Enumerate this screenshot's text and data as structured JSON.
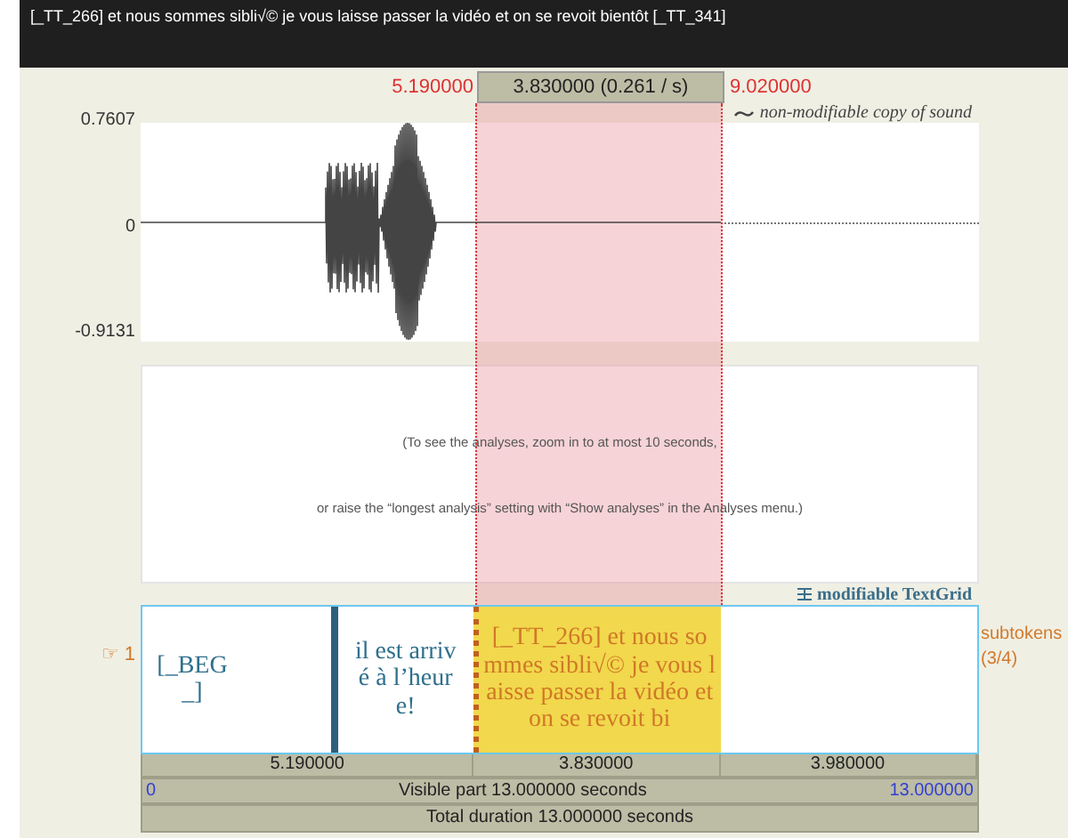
{
  "top_bar": {
    "text": "[_TT_266] et nous sommes sibli√© je vous laisse passer la vidéo et on se revoit bientôt [_TT_341]"
  },
  "selection": {
    "start": "5.190000",
    "duration": "3.830000 (0.261 / s)",
    "end": "9.020000"
  },
  "sound": {
    "label": "non-modifiable copy of sound",
    "ymax": "0.7607",
    "yzero": "0",
    "ymin": "-0.9131"
  },
  "analyses_message": [
    "(To see the analyses, zoom in to at most 10 seconds,",
    "or raise the “longest analysis” setting with “Show analyses” in the Analyses menu.)"
  ],
  "textgrid": {
    "label": "modifiable TextGrid",
    "tier": {
      "marker": "☞",
      "number": "1",
      "name": "subtokens",
      "count": "(3/4)",
      "intervals": [
        {
          "text": "[_BEG_]",
          "selected": false
        },
        {
          "text": "il est  arrivé à l’heure!",
          "selected": false
        },
        {
          "text": "[_TT_266] et nous sommes sibli√© je vous laisse passer la vidéo et on se revoit bi",
          "selected": true
        },
        {
          "selected": false
        }
      ]
    }
  },
  "duration_row": [
    "5.190000",
    "3.830000",
    "3.980000"
  ],
  "visible_row": {
    "start": "0",
    "text": "Visible part 13.000000 seconds",
    "end": "13.000000"
  },
  "total_row": "Total duration 13.000000 seconds"
}
